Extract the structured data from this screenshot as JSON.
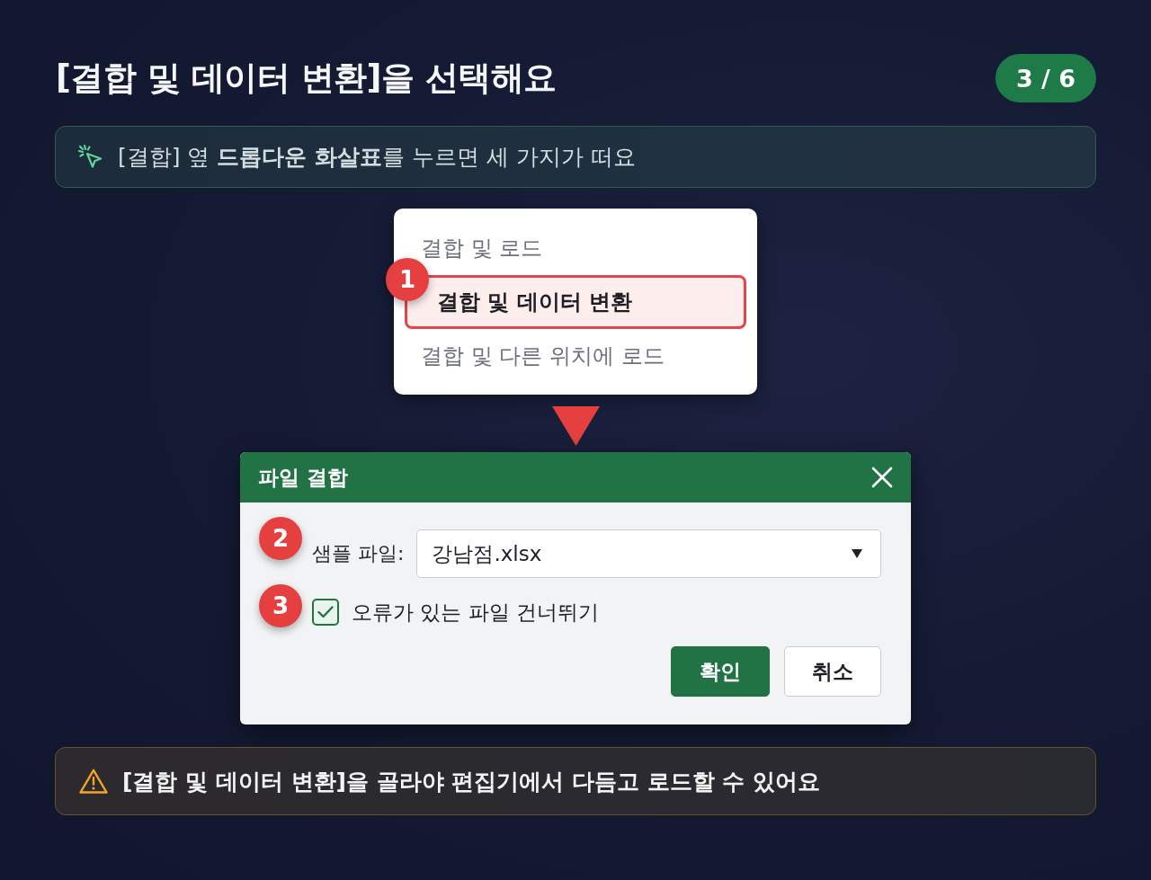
{
  "header": {
    "title": "**[결합 및 데이터 변환]**을 선택해요",
    "page": "3 / 6"
  },
  "tip": {
    "text": "[결합] 옆 **드롭다운 화살표**를 누르면 세 가지가 떠요"
  },
  "menu": {
    "items": [
      {
        "label": "결합 및 로드",
        "selected": false
      },
      {
        "label": "결합 및 데이터 변환",
        "selected": true,
        "step": "1"
      },
      {
        "label": "결합 및 다른 위치에 로드",
        "selected": false
      }
    ]
  },
  "dialog": {
    "title": "파일 결합",
    "fields": [
      {
        "kind": "select",
        "step": "2",
        "label": "샘플 파일:",
        "value": "강남점.xlsx"
      },
      {
        "kind": "checkbox",
        "step": "3",
        "label": "오류가 있는 파일 건너뛰기",
        "checked": true
      }
    ],
    "buttons": [
      {
        "label": "확인",
        "kind": "primary"
      },
      {
        "label": "취소",
        "kind": "secondary"
      }
    ]
  },
  "warning": {
    "text": "**[결합 및 데이터 변환]**을 골라야 편집기에서 다듬고 로드할 수 있어요"
  }
}
